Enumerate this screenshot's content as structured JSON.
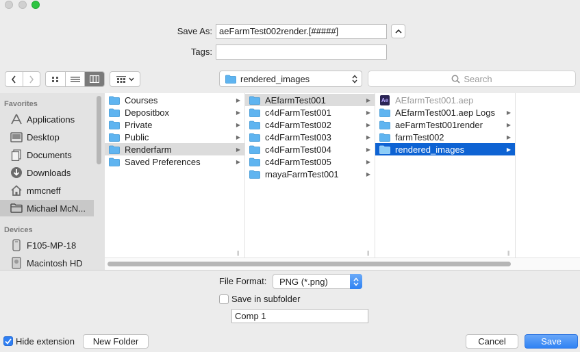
{
  "window": {
    "traffic_lights": [
      "close",
      "minimize",
      "zoom"
    ]
  },
  "save_as": {
    "label": "Save As:",
    "value": "aeFarmTest002render.[#####]"
  },
  "tags": {
    "label": "Tags:",
    "value": ""
  },
  "toolbar": {
    "location": "rendered_images",
    "search_placeholder": "Search"
  },
  "sidebar": {
    "favorites_header": "Favorites",
    "favorites": [
      {
        "label": "Applications",
        "icon": "applications-icon"
      },
      {
        "label": "Desktop",
        "icon": "desktop-icon"
      },
      {
        "label": "Documents",
        "icon": "documents-icon"
      },
      {
        "label": "Downloads",
        "icon": "downloads-icon"
      },
      {
        "label": "mmcneff",
        "icon": "home-icon"
      },
      {
        "label": "Michael McN...",
        "icon": "folder-icon",
        "selected": true
      }
    ],
    "devices_header": "Devices",
    "devices": [
      {
        "label": "F105-MP-18",
        "icon": "computer-icon"
      },
      {
        "label": "Macintosh HD",
        "icon": "drive-icon"
      }
    ]
  },
  "columns": [
    {
      "items": [
        {
          "label": "Courses",
          "arrow": true
        },
        {
          "label": "Depositbox",
          "arrow": true
        },
        {
          "label": "Private",
          "arrow": true
        },
        {
          "label": "Public",
          "arrow": true
        },
        {
          "label": "Renderfarm",
          "arrow": true,
          "state": "path"
        },
        {
          "label": "Saved Preferences",
          "arrow": true
        }
      ]
    },
    {
      "items": [
        {
          "label": "AEfarmTest001",
          "arrow": true,
          "state": "path"
        },
        {
          "label": "c4dFarmTest001",
          "arrow": true
        },
        {
          "label": "c4dFarmTest002",
          "arrow": true
        },
        {
          "label": "c4dFarmTest003",
          "arrow": true
        },
        {
          "label": "c4dFarmTest004",
          "arrow": true
        },
        {
          "label": "c4dFarmTest005",
          "arrow": true
        },
        {
          "label": "mayaFarmTest001",
          "arrow": true
        }
      ]
    },
    {
      "items": [
        {
          "label": "AEfarmTest001.aep",
          "arrow": false,
          "kind": "ae-file",
          "state": "dim"
        },
        {
          "label": "AEfarmTest001.aep Logs",
          "arrow": true
        },
        {
          "label": "aeFarmTest001render",
          "arrow": true
        },
        {
          "label": "farmTest002",
          "arrow": true
        },
        {
          "label": "rendered_images",
          "arrow": true,
          "state": "selected"
        }
      ]
    }
  ],
  "ae_badge": "Ae",
  "options": {
    "file_format_label": "File Format:",
    "file_format_value": "PNG (*.png)",
    "subfolder_label": "Save in subfolder",
    "subfolder_checked": false,
    "subfolder_name": "Comp 1"
  },
  "footer": {
    "hide_extension_label": "Hide extension",
    "hide_extension_checked": true,
    "new_folder": "New Folder",
    "cancel": "Cancel",
    "save": "Save"
  },
  "colors": {
    "accent": "#0e63d3",
    "folder": "#5fb4f0",
    "traffic_green": "#2ec442"
  }
}
